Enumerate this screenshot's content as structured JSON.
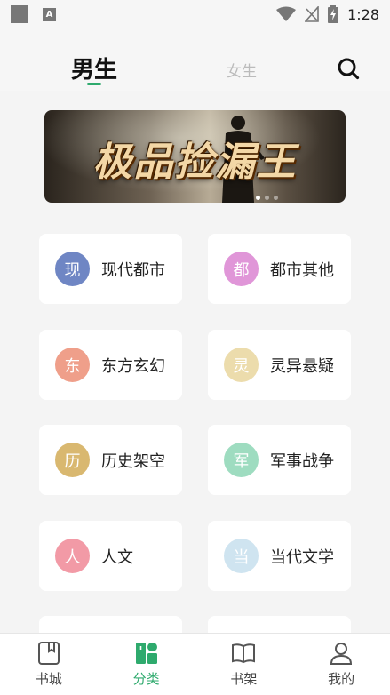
{
  "status_bar": {
    "time": "1:28",
    "left_icons": [
      "square-icon",
      "a-icon"
    ],
    "right_icons": [
      "wifi-icon",
      "no-signal-icon",
      "battery-charging-icon"
    ],
    "a_letter": "A"
  },
  "header": {
    "tabs": [
      {
        "label": "男生",
        "active": true
      },
      {
        "label": "女生",
        "active": false
      }
    ],
    "accent_color": "#2eaa6d",
    "search_icon": "search-icon"
  },
  "banner": {
    "title": "极品捡漏王",
    "slide_count": 3,
    "active_slide": 1
  },
  "categories": [
    {
      "badge": "现",
      "label": "现代都市",
      "color": "#6f86c4"
    },
    {
      "badge": "都",
      "label": "都市其他",
      "color": "#e096d8"
    },
    {
      "badge": "东",
      "label": "东方玄幻",
      "color": "#ef9f8a"
    },
    {
      "badge": "灵",
      "label": "灵异悬疑",
      "color": "#ecdcac"
    },
    {
      "badge": "历",
      "label": "历史架空",
      "color": "#d9b870"
    },
    {
      "badge": "军",
      "label": "军事战争",
      "color": "#9edcc0"
    },
    {
      "badge": "人",
      "label": "人文",
      "color": "#f29aa6"
    },
    {
      "badge": "当",
      "label": "当代文学",
      "color": "#cfe4f0"
    }
  ],
  "bottom_nav": [
    {
      "label": "书城",
      "icon": "book-city-icon",
      "active": false
    },
    {
      "label": "分类",
      "icon": "category-icon",
      "active": true
    },
    {
      "label": "书架",
      "icon": "bookshelf-icon",
      "active": false
    },
    {
      "label": "我的",
      "icon": "profile-icon",
      "active": false
    }
  ]
}
